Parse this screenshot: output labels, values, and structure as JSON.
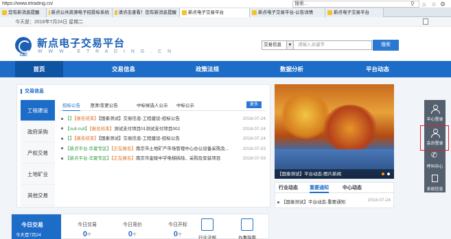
{
  "browser": {
    "url": "https://www.etrading.cn/",
    "search_text": "搜索...",
    "tabs": [
      {
        "label": "您有新消息提醒",
        "active": false
      },
      {
        "label": "新点公共资源电子招投标系统",
        "active": false
      },
      {
        "label": "请点击查看！您有新消息提醒",
        "active": false
      },
      {
        "label": "新点电子交易平台",
        "active": true
      },
      {
        "label": "新点电子交易平台-公告详情",
        "active": false
      },
      {
        "label": "新点电子交易平台",
        "active": false
      }
    ]
  },
  "infobar": {
    "date": "今天是：2018年7月24日  星期二"
  },
  "header": {
    "title": "新点电子交易平台",
    "subtitle": "W W W . E T R A D I N G . C N",
    "logo_text": "CBC",
    "search_select": "交易信息",
    "search_placeholder": "请输入关键字",
    "search_button": "搜索"
  },
  "nav": [
    {
      "label": "首页",
      "active": true
    },
    {
      "label": "交易信息",
      "active": false
    },
    {
      "label": "政策法规",
      "active": false
    },
    {
      "label": "数据分析",
      "active": false
    },
    {
      "label": "平台动态",
      "active": false
    }
  ],
  "trade_panel": {
    "title": "交易信息",
    "side_tabs": [
      {
        "label": "工程建设",
        "active": true
      },
      {
        "label": "政府采购",
        "active": false
      },
      {
        "label": "产权交易",
        "active": false
      },
      {
        "label": "土地矿业",
        "active": false
      },
      {
        "label": "其他交易",
        "active": false
      }
    ],
    "sub_tabs": [
      {
        "label": "招标公告",
        "active": true
      },
      {
        "label": "澄清/变更公告",
        "active": false
      },
      {
        "label": "中标候选人公示",
        "active": false
      },
      {
        "label": "中标公示",
        "active": false
      }
    ],
    "more_label": "更多",
    "rows": [
      {
        "prefix": "【】",
        "status": "【报名结束】",
        "title": "【国泰测试】交易信息-工程建设-招标公告",
        "date": "2018-07-24"
      },
      {
        "prefix": "【null-null】",
        "status": "【报名结束】",
        "title": "测试支付项目01测试支付项目002",
        "date": "2018-07-24"
      },
      {
        "prefix": "【】",
        "status": "【报名结束】",
        "title": "【国泰测试】交易信息-工程建设-招标公告",
        "date": "2018-07-24"
      },
      {
        "prefix": "【新点平台-华夏专区】",
        "status": "【正在报名】",
        "title": "南京市土地矿产市场管理中心办公设备采购及...",
        "date": "2018-07-03"
      },
      {
        "prefix": "【新点平台-华夏专区】",
        "status": "【正在报名】",
        "title": "南京市金陵中学电梯拆除、采购及安装项目",
        "date": "2018-07-03"
      }
    ]
  },
  "photo": {
    "caption": "【国泰测试】平台动态-图片新闻"
  },
  "news": {
    "tabs": [
      {
        "label": "行业动态",
        "active": false
      },
      {
        "label": "重要通知",
        "active": true
      },
      {
        "label": "中心动态",
        "active": false
      }
    ],
    "rows": [
      {
        "title": "【国泰测试】平台动态-重要通知",
        "date": "2018-07-24"
      }
    ]
  },
  "stats": {
    "today_label": "今日交易",
    "today_date": "今天是7月24",
    "items": [
      {
        "label": "今日交易",
        "value": "0",
        "unit": "个"
      },
      {
        "label": "今日竞价",
        "value": "0",
        "unit": "个"
      },
      {
        "label": "今日开标",
        "value": "0",
        "unit": "个"
      }
    ],
    "quick_links": [
      {
        "label": "行业法规",
        "icon": "book-icon"
      },
      {
        "label": "办事指南",
        "icon": "guide-icon"
      }
    ]
  },
  "floatbar": [
    {
      "label": "中心登录",
      "icon": "person-icon"
    },
    {
      "label": "会员登录",
      "icon": "person-icon"
    },
    {
      "label": "呼叫中心",
      "icon": "phone-icon"
    },
    {
      "label": "系统信息",
      "icon": "doc-icon"
    }
  ],
  "colors": {
    "brand": "#1c6cc8",
    "highlight": "#e02020",
    "green": "#2e9b3d",
    "orange": "#e07020"
  }
}
